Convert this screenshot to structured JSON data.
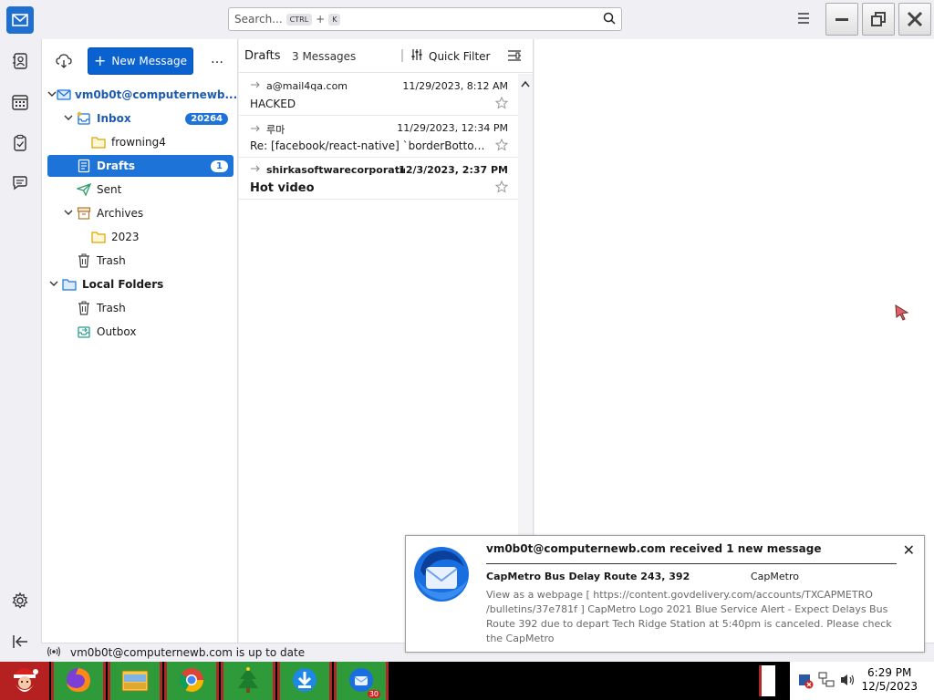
{
  "app": {
    "search_placeholder": "Search...",
    "search_kbd_ctrl": "CTRL",
    "search_kbd_plus": "+",
    "search_kbd_key": "K"
  },
  "folder_pane": {
    "new_message_label": "New Message",
    "more_label": "…",
    "tree": [
      {
        "label": "vm0b0t@computernewb...",
        "badge": ""
      },
      {
        "label": "Inbox",
        "badge": "20264"
      },
      {
        "label": "frowning4",
        "badge": ""
      },
      {
        "label": "Drafts",
        "badge": "1"
      },
      {
        "label": "Sent",
        "badge": ""
      },
      {
        "label": "Archives",
        "badge": ""
      },
      {
        "label": "2023",
        "badge": ""
      },
      {
        "label": "Trash",
        "badge": ""
      },
      {
        "label": "Local Folders",
        "badge": ""
      },
      {
        "label": "Trash",
        "badge": ""
      },
      {
        "label": "Outbox",
        "badge": ""
      }
    ]
  },
  "message_list": {
    "folder_title": "Drafts",
    "count_label": "3 Messages",
    "quick_filter_label": "Quick Filter",
    "messages": [
      {
        "from": "a@mail4qa.com",
        "date": "11/29/2023, 8:12 AM",
        "subject": "HACKED"
      },
      {
        "from": "루마",
        "date": "11/29/2023, 12:34 PM",
        "subject": "Re: [facebook/react-native] `borderBottom..."
      },
      {
        "from": "shirkasoftwarecorporatio...",
        "date": "12/3/2023, 2:37 PM",
        "subject": "Hot video"
      }
    ]
  },
  "status_bar": {
    "text": "vm0b0t@computernewb.com is up to date"
  },
  "notification": {
    "title": "vm0b0t@computernewb.com received 1 new message",
    "subject": "CapMetro Bus Delay Route 243, 392",
    "sender": "CapMetro",
    "body": "View as a webpage [ https://content.govdelivery.com/accounts/TXCAPMETRO /bulletins/37e781f ] CapMetro Logo 2021 Blue Service Alert - Expect Delays Bus Route 392 due to depart Tech Ridge Station at 5:40pm is canceled. Please check the CapMetro",
    "close_label": "✕"
  },
  "taskbar": {
    "badge_count": "30",
    "time": "6:29 PM",
    "date": "12/5/2023"
  },
  "colors": {
    "accent": "#1d73d8",
    "taskbar_app": "#2e9a3a",
    "taskbar_border": "#b0282a"
  }
}
